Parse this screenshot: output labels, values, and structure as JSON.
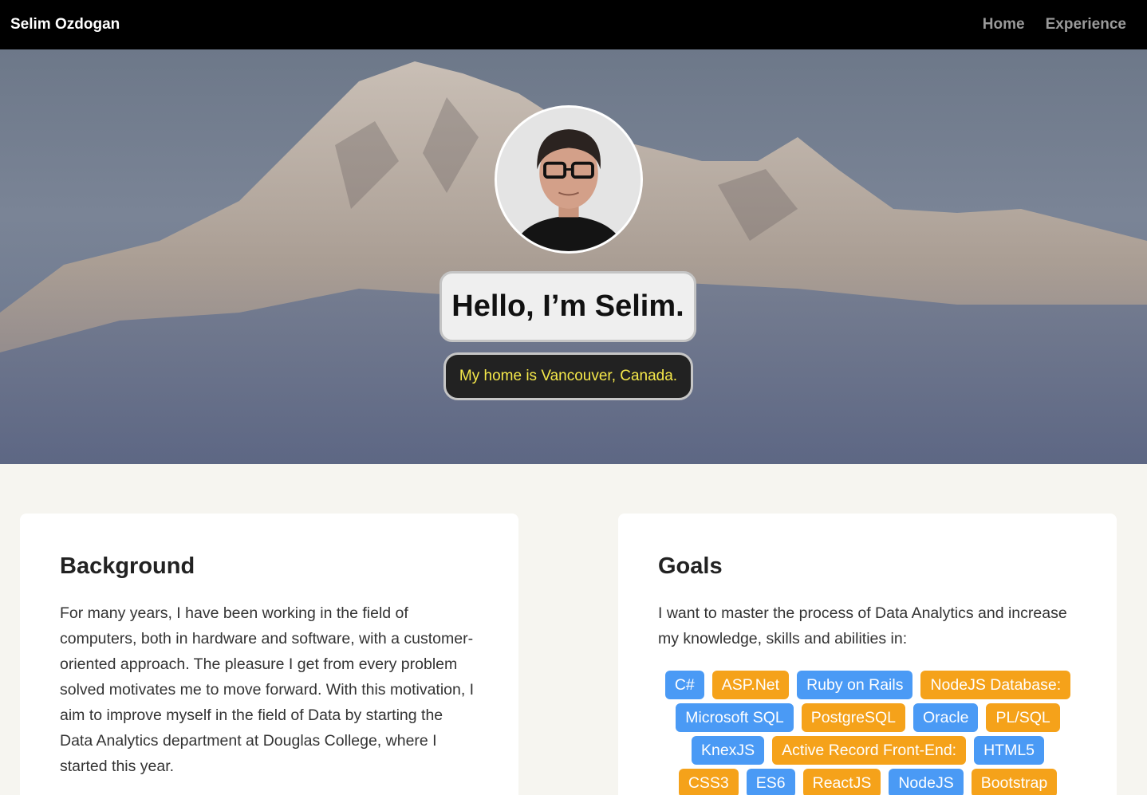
{
  "nav": {
    "brand": "Selim Ozdogan",
    "links": [
      "Home",
      "Experience"
    ]
  },
  "hero": {
    "greeting": "Hello, I’m Selim.",
    "location": "My home is Vancouver, Canada."
  },
  "background": {
    "title": "Background",
    "text": "For many years, I have been working in the field of computers, both in hardware and software, with a customer-oriented approach. The pleasure I get from every problem solved motivates me to move forward. With this motivation, I aim to improve myself in the field of Data by starting the Data Analytics department at Douglas College, where I started this year."
  },
  "goals": {
    "title": "Goals",
    "text": "I want to master the process of Data Analytics and increase my knowledge, skills and abilities in:",
    "tags": [
      {
        "label": "C#",
        "color": "blue"
      },
      {
        "label": "ASP.Net",
        "color": "orange"
      },
      {
        "label": "Ruby on Rails",
        "color": "blue"
      },
      {
        "label": "NodeJS Database:",
        "color": "orange"
      },
      {
        "label": "Microsoft SQL",
        "color": "blue"
      },
      {
        "label": "PostgreSQL",
        "color": "orange"
      },
      {
        "label": "Oracle",
        "color": "blue"
      },
      {
        "label": "PL/SQL",
        "color": "orange"
      },
      {
        "label": "KnexJS",
        "color": "blue"
      },
      {
        "label": "Active Record Front-End:",
        "color": "orange"
      },
      {
        "label": "HTML5",
        "color": "blue"
      },
      {
        "label": "CSS3",
        "color": "orange"
      },
      {
        "label": "ES6",
        "color": "blue"
      },
      {
        "label": "ReactJS",
        "color": "orange"
      },
      {
        "label": "NodeJS",
        "color": "blue"
      },
      {
        "label": "Bootstrap",
        "color": "orange"
      }
    ]
  },
  "colors": {
    "navbar": "#000000",
    "tag_blue": "#4a9af5",
    "tag_orange": "#f5a21a",
    "location_text": "#f6e94a"
  }
}
